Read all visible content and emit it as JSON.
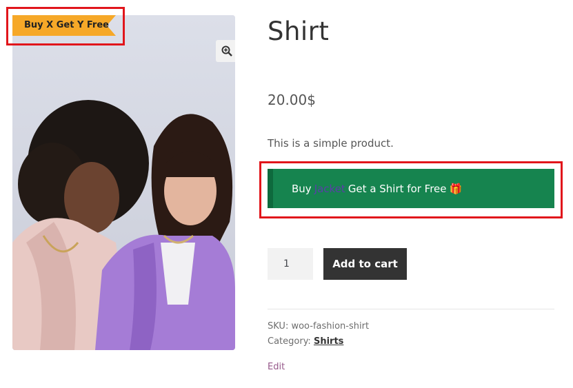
{
  "badge": {
    "label": "Buy X Get Y Free",
    "color": "#f6a828"
  },
  "product": {
    "title": "Shirt",
    "price": "20.00$",
    "short_description": "This is a simple product."
  },
  "offer": {
    "prefix": "Buy",
    "linked_product": "Jacket",
    "suffix": "Get a Shirt for Free",
    "gift_emoji": "🎁",
    "background": "#16844f"
  },
  "cart": {
    "quantity": "1",
    "add_label": "Add to cart"
  },
  "meta": {
    "sku_label": "SKU:",
    "sku_value": "woo-fashion-shirt",
    "category_label": "Category:",
    "category_value": "Shirts"
  },
  "edit_label": "Edit",
  "icons": {
    "zoom": "magnifier-zoom-icon"
  }
}
